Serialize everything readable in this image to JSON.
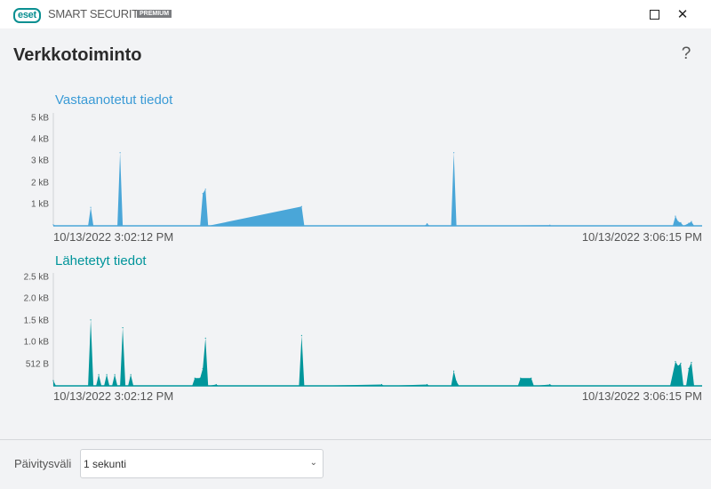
{
  "titlebar": {
    "logo": "eset",
    "product": "SMART SECURITY",
    "edition": "PREMIUM",
    "minimize_icon": "square-icon",
    "close_icon": "close-icon"
  },
  "page": {
    "title": "Verkkotoiminto",
    "help": "?"
  },
  "colors": {
    "received": "#4aa6d8",
    "received_title": "#3b9bd6",
    "sent": "#00969b",
    "sent_title": "#00949a"
  },
  "chart_data": [
    {
      "type": "area",
      "title": "Vastaanotetut tiedot",
      "xlabel_start": "10/13/2022 3:02:12 PM",
      "xlabel_end": "10/13/2022 3:06:15 PM",
      "x_unit": "seconds since start",
      "xlim": [
        0,
        243
      ],
      "ylim": [
        0,
        5
      ],
      "yticks": [
        {
          "value": 5,
          "label": "5 kB"
        },
        {
          "value": 4,
          "label": "4 kB"
        },
        {
          "value": 3,
          "label": "3 kB"
        },
        {
          "value": 2,
          "label": "2 kB"
        },
        {
          "value": 1,
          "label": "1 kB"
        }
      ],
      "y_unit": "kB",
      "points": [
        [
          0,
          0.05
        ],
        [
          1,
          0
        ],
        [
          13,
          0
        ],
        [
          14,
          0.86
        ],
        [
          15,
          0
        ],
        [
          24,
          0
        ],
        [
          25,
          3.4
        ],
        [
          26,
          0
        ],
        [
          55,
          0
        ],
        [
          56,
          1.5
        ],
        [
          57,
          1.7
        ],
        [
          58,
          0
        ],
        [
          93,
          0.9
        ],
        [
          94,
          0
        ],
        [
          139,
          0
        ],
        [
          140,
          0.1
        ],
        [
          141,
          0
        ],
        [
          149,
          0
        ],
        [
          150,
          3.4
        ],
        [
          151,
          0
        ],
        [
          186,
          0.03
        ],
        [
          187,
          0
        ],
        [
          232,
          0
        ],
        [
          233,
          0.45
        ],
        [
          234,
          0.2
        ],
        [
          235,
          0.15
        ],
        [
          236,
          0
        ],
        [
          238,
          0.12
        ],
        [
          239,
          0.2
        ],
        [
          240,
          0
        ],
        [
          243,
          0
        ]
      ]
    },
    {
      "type": "area",
      "title": "Lähetetyt tiedot",
      "xlabel_start": "10/13/2022 3:02:12 PM",
      "xlabel_end": "10/13/2022 3:06:15 PM",
      "x_unit": "seconds since start",
      "xlim": [
        0,
        243
      ],
      "ylim": [
        0,
        2.5
      ],
      "yticks": [
        {
          "value": 2.5,
          "label": "2.5 kB"
        },
        {
          "value": 2.0,
          "label": "2.0 kB"
        },
        {
          "value": 1.5,
          "label": "1.5 kB"
        },
        {
          "value": 1.0,
          "label": "1.0 kB"
        },
        {
          "value": 0.5,
          "label": "512 B"
        }
      ],
      "y_unit": "kB",
      "points": [
        [
          0,
          0.12
        ],
        [
          1,
          0
        ],
        [
          13,
          0
        ],
        [
          14,
          1.52
        ],
        [
          15,
          0
        ],
        [
          16,
          0
        ],
        [
          17,
          0.26
        ],
        [
          18,
          0
        ],
        [
          19,
          0
        ],
        [
          20,
          0.26
        ],
        [
          21,
          0
        ],
        [
          22,
          0
        ],
        [
          23,
          0.26
        ],
        [
          24,
          0
        ],
        [
          25,
          0
        ],
        [
          26,
          1.34
        ],
        [
          27,
          0
        ],
        [
          28,
          0
        ],
        [
          29,
          0.26
        ],
        [
          30,
          0
        ],
        [
          52,
          0
        ],
        [
          53,
          0.18
        ],
        [
          55,
          0.18
        ],
        [
          56,
          0.4
        ],
        [
          57,
          1.1
        ],
        [
          58,
          0
        ],
        [
          61,
          0.03
        ],
        [
          62,
          0
        ],
        [
          92,
          0
        ],
        [
          93,
          1.16
        ],
        [
          94,
          0
        ],
        [
          123,
          0.03
        ],
        [
          124,
          0
        ],
        [
          140,
          0.03
        ],
        [
          141,
          0
        ],
        [
          149,
          0
        ],
        [
          150,
          0.34
        ],
        [
          151,
          0.1
        ],
        [
          152,
          0
        ],
        [
          174,
          0
        ],
        [
          175,
          0.18
        ],
        [
          179,
          0.18
        ],
        [
          180,
          0
        ],
        [
          186,
          0.03
        ],
        [
          187,
          0
        ],
        [
          231,
          0
        ],
        [
          233,
          0.56
        ],
        [
          234,
          0.46
        ],
        [
          235,
          0.52
        ],
        [
          236,
          0
        ],
        [
          237,
          0
        ],
        [
          238,
          0.4
        ],
        [
          239,
          0.54
        ],
        [
          240,
          0
        ],
        [
          243,
          0
        ]
      ]
    }
  ],
  "footer": {
    "label": "Päivitysväli",
    "select_value": "1 sekunti",
    "chevron_icon": "chevron-down-icon"
  }
}
